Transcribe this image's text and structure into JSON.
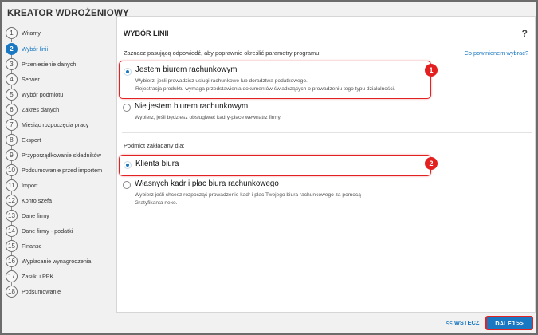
{
  "window": {
    "title": "KREATOR WDROŻENIOWY"
  },
  "steps": [
    {
      "num": "1",
      "label": "Witamy"
    },
    {
      "num": "2",
      "label": "Wybór linii",
      "active": true
    },
    {
      "num": "3",
      "label": "Przeniesienie danych"
    },
    {
      "num": "4",
      "label": "Serwer"
    },
    {
      "num": "5",
      "label": "Wybór podmiotu"
    },
    {
      "num": "6",
      "label": "Zakres danych"
    },
    {
      "num": "7",
      "label": "Miesiąc rozpoczęcia pracy"
    },
    {
      "num": "8",
      "label": "Eksport"
    },
    {
      "num": "9",
      "label": "Przyporządkowanie składników"
    },
    {
      "num": "10",
      "label": "Podsumowanie przed importem"
    },
    {
      "num": "11",
      "label": "Import"
    },
    {
      "num": "12",
      "label": "Konto szefa"
    },
    {
      "num": "13",
      "label": "Dane firmy"
    },
    {
      "num": "14",
      "label": "Dane firmy - podatki"
    },
    {
      "num": "15",
      "label": "Finanse"
    },
    {
      "num": "16",
      "label": "Wypłacanie wynagrodzenia"
    },
    {
      "num": "17",
      "label": "Zasiłki i PPK"
    },
    {
      "num": "18",
      "label": "Podsumowanie"
    }
  ],
  "main": {
    "title": "WYBÓR LINII",
    "help": "?",
    "intro": "Zaznacz pasującą odpowiedź, aby poprawnie określić parametry programu:",
    "why_link": "Co powinienem wybrać?",
    "group1": {
      "opt1": {
        "label": "Jestem biurem rachunkowym",
        "desc1": "Wybierz, jeśli prowadzisz usługi rachunkowe lub doradztwa podatkowego.",
        "desc2": "Rejestracja produktu wymaga przedstawienia dokumentów świadczących o prowadzeniu tego typu działalności.",
        "selected": true
      },
      "opt2": {
        "label": "Nie jestem biurem rachunkowym",
        "desc": "Wybierz, jeśli będziesz obsługiwać kadry-płace wewnątrz firmy.",
        "selected": false
      }
    },
    "group2": {
      "label": "Podmiot zakładany dla:",
      "opt1": {
        "label": "Klienta biura",
        "selected": true
      },
      "opt2": {
        "label": "Własnych kadr i płac biura rachunkowego",
        "desc1": "Wybierz jeśli chcesz rozpocząć prowadzenie kadr i płac Twojego biura rachunkowego za pomocą",
        "desc2": "Gratyfikanta nexo.",
        "selected": false
      }
    },
    "badges": [
      "1",
      "2"
    ]
  },
  "footer": {
    "back": "<< WSTECZ",
    "next": "DALEJ >>"
  },
  "colors": {
    "accent": "#1a78c2",
    "highlight": "#e22222"
  }
}
